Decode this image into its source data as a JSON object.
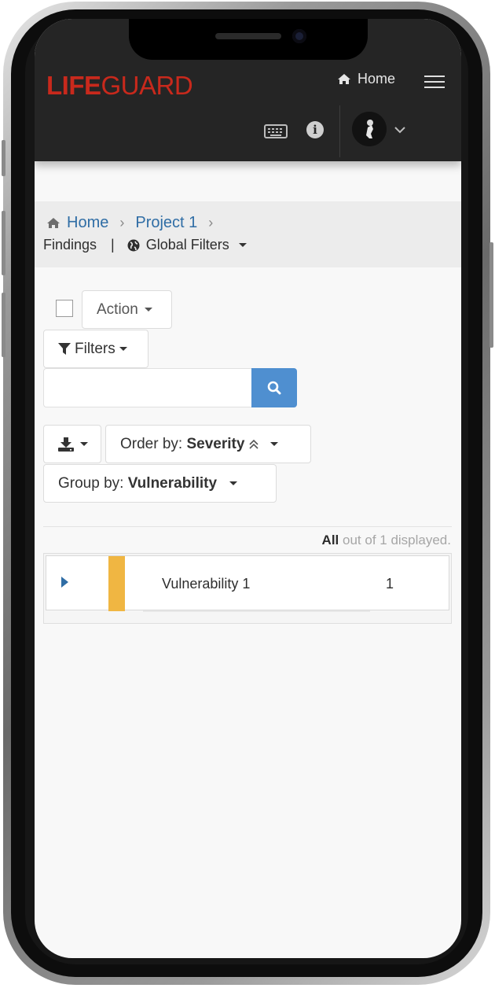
{
  "app": {
    "logo_bold": "LIFE",
    "logo_rest": "GUARD",
    "brand_color": "#c8291c"
  },
  "navbar": {
    "home_label": "Home",
    "icons": [
      "home-icon",
      "hamburger-menu-icon",
      "keyboard-icon",
      "info-icon",
      "avatar",
      "chevron-down-icon"
    ]
  },
  "breadcrumb": {
    "home": "Home",
    "project": "Project 1",
    "current": "Findings",
    "separator": "|",
    "global_filters": "Global Filters"
  },
  "toolbar": {
    "action_label": "Action",
    "filters_label": "Filters",
    "search_placeholder": "",
    "order_prefix": "Order by: ",
    "order_value": "Severity",
    "group_prefix": "Group by: ",
    "group_value": "Vulnerability"
  },
  "table": {
    "displayed_bold": "All",
    "displayed_rest": " out of 1 displayed.",
    "rows": [
      {
        "name": "Vulnerability 1",
        "count": "1",
        "severity_color": "#f0b642"
      }
    ]
  }
}
